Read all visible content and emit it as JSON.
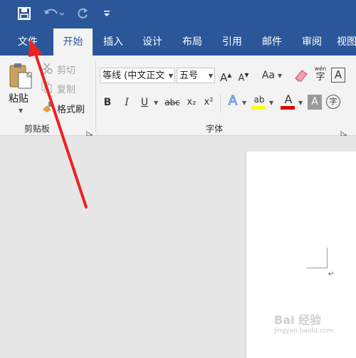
{
  "tabs": {
    "file": "文件",
    "home": "开始",
    "insert": "插入",
    "design": "设计",
    "layout": "布局",
    "references": "引用",
    "mailings": "邮件",
    "review": "审阅",
    "view": "视图"
  },
  "clipboard": {
    "paste": "粘贴",
    "cut": "剪切",
    "copy": "复制",
    "format_painter": "格式刷",
    "group_label": "剪贴板"
  },
  "font": {
    "font_name": "等线 (中文正文",
    "font_size": "五号",
    "grow": "A",
    "shrink": "A",
    "change_case": "Aa",
    "phonetic": "wén",
    "bold": "B",
    "italic": "I",
    "underline": "U",
    "strikethrough": "abc",
    "subscript": "x₂",
    "superscript": "x²",
    "text_effects": "A",
    "highlight": "ab",
    "font_color": "A",
    "char_shading": "A",
    "enclose": "字",
    "group_label": "字体"
  },
  "colors": {
    "ribbon_blue": "#2b579a",
    "highlight_yellow": "#ffff00",
    "font_red": "#e00000",
    "arrow_red": "#ee2020"
  },
  "watermark": {
    "line1": "Bai 经验",
    "line2": "jingyan.baidu.com"
  }
}
